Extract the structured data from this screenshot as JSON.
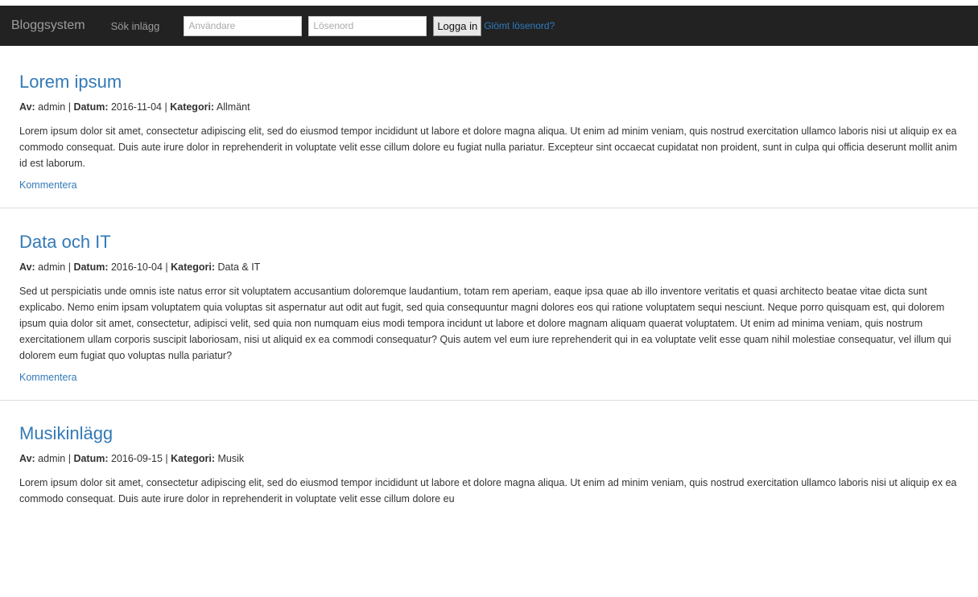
{
  "nav": {
    "brand": "Bloggsystem",
    "search_link": "Sök inlägg",
    "username_placeholder": "Användare",
    "password_placeholder": "Lösenord",
    "login_button": "Logga in",
    "forgot_link": "Glömt lösenord?"
  },
  "labels": {
    "author": "Av:",
    "date": "Datum:",
    "category": "Kategori:",
    "separator": "|"
  },
  "posts": [
    {
      "title": "Lorem ipsum",
      "author": "admin",
      "date": "2016-11-04",
      "category": "Allmänt",
      "body": "Lorem ipsum dolor sit amet, consectetur adipiscing elit, sed do eiusmod tempor incididunt ut labore et dolore magna aliqua. Ut enim ad minim veniam, quis nostrud exercitation ullamco laboris nisi ut aliquip ex ea commodo consequat. Duis aute irure dolor in reprehenderit in voluptate velit esse cillum dolore eu fugiat nulla pariatur. Excepteur sint occaecat cupidatat non proident, sunt in culpa qui officia deserunt mollit anim id est laborum.",
      "comment_link": "Kommentera"
    },
    {
      "title": "Data och IT",
      "author": "admin",
      "date": "2016-10-04",
      "category": "Data & IT",
      "body": "Sed ut perspiciatis unde omnis iste natus error sit voluptatem accusantium doloremque laudantium, totam rem aperiam, eaque ipsa quae ab illo inventore veritatis et quasi architecto beatae vitae dicta sunt explicabo. Nemo enim ipsam voluptatem quia voluptas sit aspernatur aut odit aut fugit, sed quia consequuntur magni dolores eos qui ratione voluptatem sequi nesciunt. Neque porro quisquam est, qui dolorem ipsum quia dolor sit amet, consectetur, adipisci velit, sed quia non numquam eius modi tempora incidunt ut labore et dolore magnam aliquam quaerat voluptatem. Ut enim ad minima veniam, quis nostrum exercitationem ullam corporis suscipit laboriosam, nisi ut aliquid ex ea commodi consequatur? Quis autem vel eum iure reprehenderit qui in ea voluptate velit esse quam nihil molestiae consequatur, vel illum qui dolorem eum fugiat quo voluptas nulla pariatur?",
      "comment_link": "Kommentera"
    },
    {
      "title": "Musikinlägg",
      "author": "admin",
      "date": "2016-09-15",
      "category": "Musik",
      "body": "Lorem ipsum dolor sit amet, consectetur adipiscing elit, sed do eiusmod tempor incididunt ut labore et dolore magna aliqua. Ut enim ad minim veniam, quis nostrud exercitation ullamco laboris nisi ut aliquip ex ea commodo consequat. Duis aute irure dolor in reprehenderit in voluptate velit esse cillum dolore eu",
      "comment_link": ""
    }
  ],
  "colors": {
    "navbar": "#222222",
    "link": "#337ab7",
    "text": "#333333"
  }
}
